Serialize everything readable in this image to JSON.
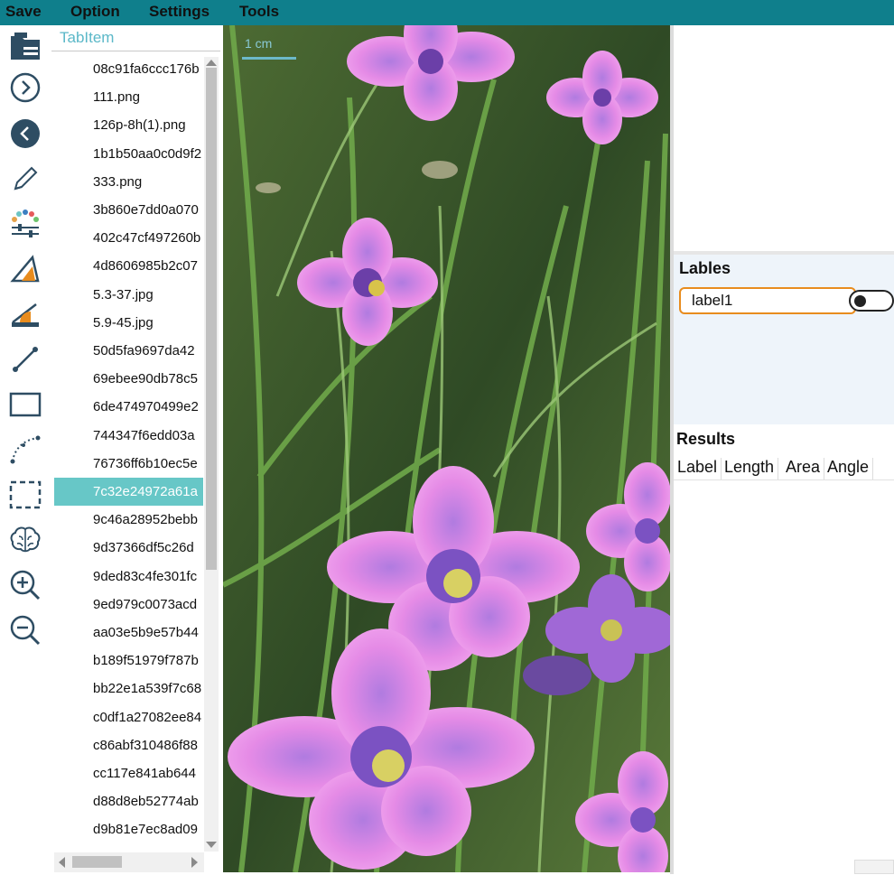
{
  "menu": {
    "save": "Save",
    "option": "Option",
    "settings": "Settings",
    "tools": "Tools"
  },
  "toolbar": {
    "tools": [
      "folder-icon",
      "arrow-right-circle-icon",
      "arrow-left-circle-icon",
      "pencil-icon",
      "color-palette-icon",
      "triangle-measure-icon",
      "angle-ruler-icon",
      "line-icon",
      "rectangle-icon",
      "curve-icon",
      "dashed-selection-icon",
      "brain-icon",
      "zoom-in-icon",
      "zoom-out-icon"
    ]
  },
  "file_panel": {
    "tab_label": "TabItem",
    "selected_index": 15,
    "files": [
      "08c91fa6ccc176b",
      "111.png",
      "126p-8h(1).png",
      "1b1b50aa0c0d9f2",
      "333.png",
      "3b860e7dd0a070",
      "402c47cf497260b",
      "4d8606985b2c07",
      "5.3-37.jpg",
      "5.9-45.jpg",
      "50d5fa9697da42",
      "69ebee90db78c5",
      "6de474970499e2",
      "744347f6edd03a",
      "76736ff6b10ec5e",
      "7c32e24972a61a",
      "9c46a28952bebb",
      "9d37366df5c26d",
      "9ded83c4fe301fc",
      "9ed979c0073acd",
      "aa03e5b9e57b44",
      "b189f51979f787b",
      "bb22e1a539f7c68",
      "c0df1a27082ee84",
      "c86abf310486f88",
      "cc117e841ab644",
      "d88d8eb52774ab",
      "d9b81e7ec8ad09"
    ]
  },
  "viewer": {
    "tab_label": "1 cm"
  },
  "labels_panel": {
    "title": "Lables",
    "label_value": "label1",
    "toggle_on": false
  },
  "results_panel": {
    "title": "Results",
    "columns": [
      "Label",
      "Length",
      "Area",
      "Angle"
    ]
  },
  "colors": {
    "menubar": "#0f7f8c",
    "selected_row": "#67c7c7",
    "accent_border": "#e88c1e",
    "icon_dark": "#2e4d63"
  }
}
